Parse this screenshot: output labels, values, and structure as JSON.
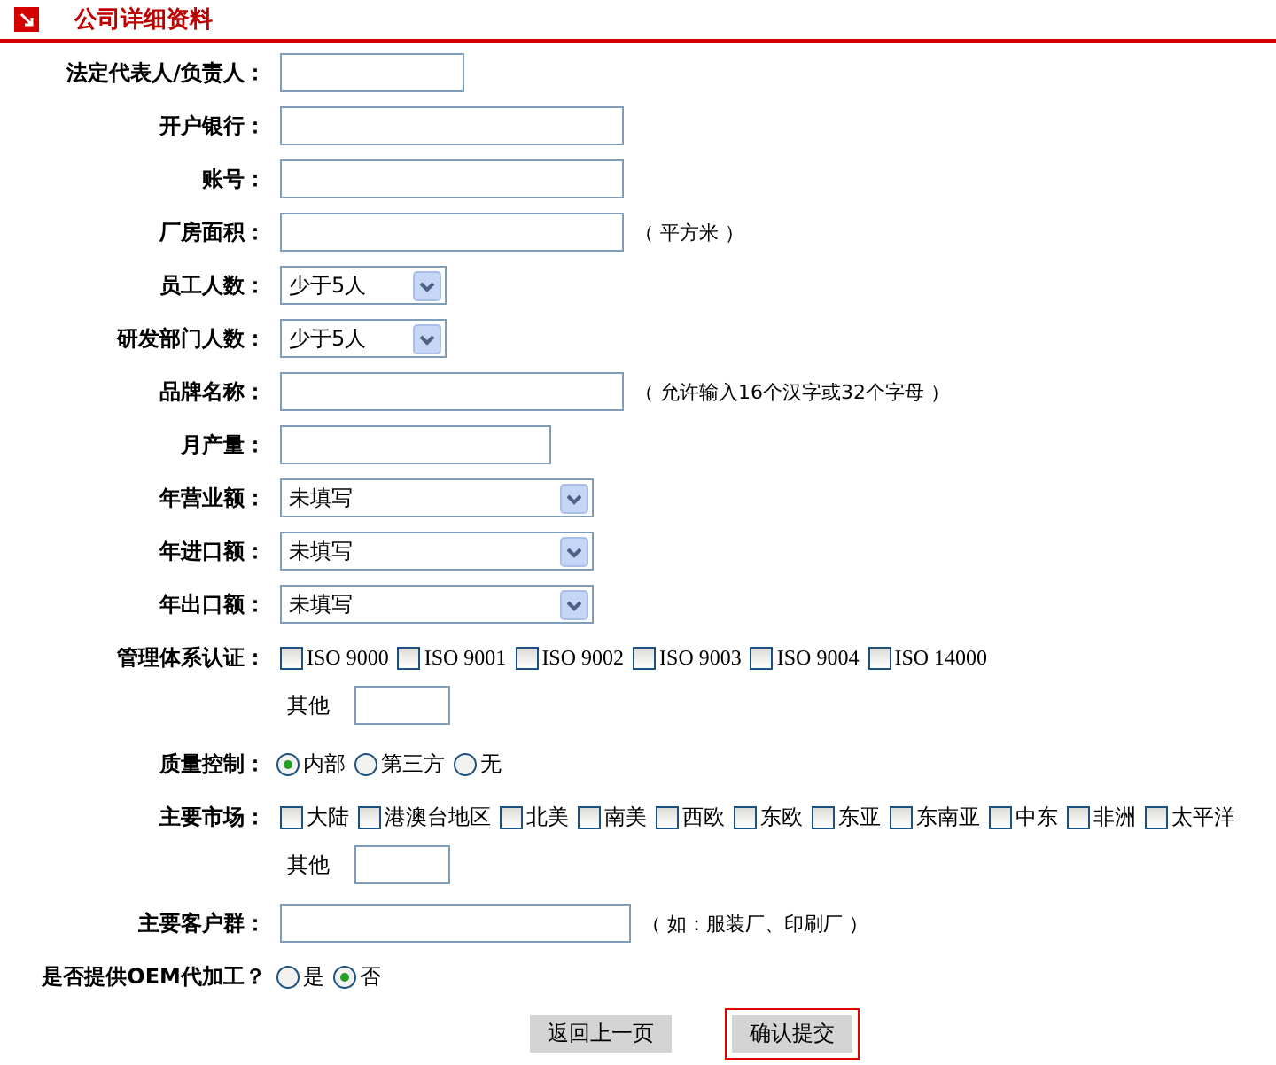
{
  "header": {
    "title": "公司详细资料"
  },
  "fields": [
    {
      "kind": "text",
      "label": "法定代表人/负责人："
    },
    {
      "kind": "text",
      "label": "开户银行："
    },
    {
      "kind": "text",
      "label": "账号："
    },
    {
      "kind": "text",
      "label": "厂房面积：",
      "note": "（ 平方米 ）"
    },
    {
      "kind": "select",
      "label": "员工人数：",
      "value": "少于5人"
    },
    {
      "kind": "select",
      "label": "研发部门人数：",
      "value": "少于5人"
    },
    {
      "kind": "text",
      "label": "品牌名称：",
      "note": "（ 允许输入16个汉字或32个字母 ）"
    },
    {
      "kind": "text",
      "label": "月产量："
    },
    {
      "kind": "select",
      "label": "年营业额：",
      "value": "未填写"
    },
    {
      "kind": "select",
      "label": "年进口额：",
      "value": "未填写"
    },
    {
      "kind": "select",
      "label": "年出口额：",
      "value": "未填写"
    },
    {
      "kind": "checks",
      "label": "管理体系认证：",
      "other_label": "其他",
      "options": [
        {
          "label": "ISO 9000",
          "checked": false
        },
        {
          "label": "ISO 9001",
          "checked": false
        },
        {
          "label": "ISO 9002",
          "checked": false
        },
        {
          "label": "ISO 9003",
          "checked": false
        },
        {
          "label": "ISO 9004",
          "checked": false
        },
        {
          "label": "ISO 14000",
          "checked": false
        }
      ]
    },
    {
      "kind": "radios",
      "label": "质量控制：",
      "options": [
        {
          "label": "内部",
          "selected": true
        },
        {
          "label": "第三方",
          "selected": false
        },
        {
          "label": "无",
          "selected": false
        }
      ]
    },
    {
      "kind": "checks",
      "label": "主要市场：",
      "other_label": "其他",
      "options": [
        {
          "label": "大陆",
          "checked": false
        },
        {
          "label": "港澳台地区",
          "checked": false
        },
        {
          "label": "北美",
          "checked": false
        },
        {
          "label": "南美",
          "checked": false
        },
        {
          "label": "西欧",
          "checked": false
        },
        {
          "label": "东欧",
          "checked": false
        },
        {
          "label": "东亚",
          "checked": false
        },
        {
          "label": "东南亚",
          "checked": false
        },
        {
          "label": "中东",
          "checked": false
        },
        {
          "label": "非洲",
          "checked": false
        },
        {
          "label": "太平洋",
          "checked": false
        }
      ]
    },
    {
      "kind": "text",
      "label": "主要客户群：",
      "note": "（ 如：服装厂、印刷厂 ）"
    },
    {
      "kind": "radios",
      "label": "是否提供OEM代加工？",
      "options": [
        {
          "label": "是",
          "selected": false
        },
        {
          "label": "否",
          "selected": true
        }
      ]
    }
  ],
  "buttons": [
    {
      "label": "返回上一页",
      "selected": false
    },
    {
      "label": "确认提交",
      "selected": true
    }
  ]
}
